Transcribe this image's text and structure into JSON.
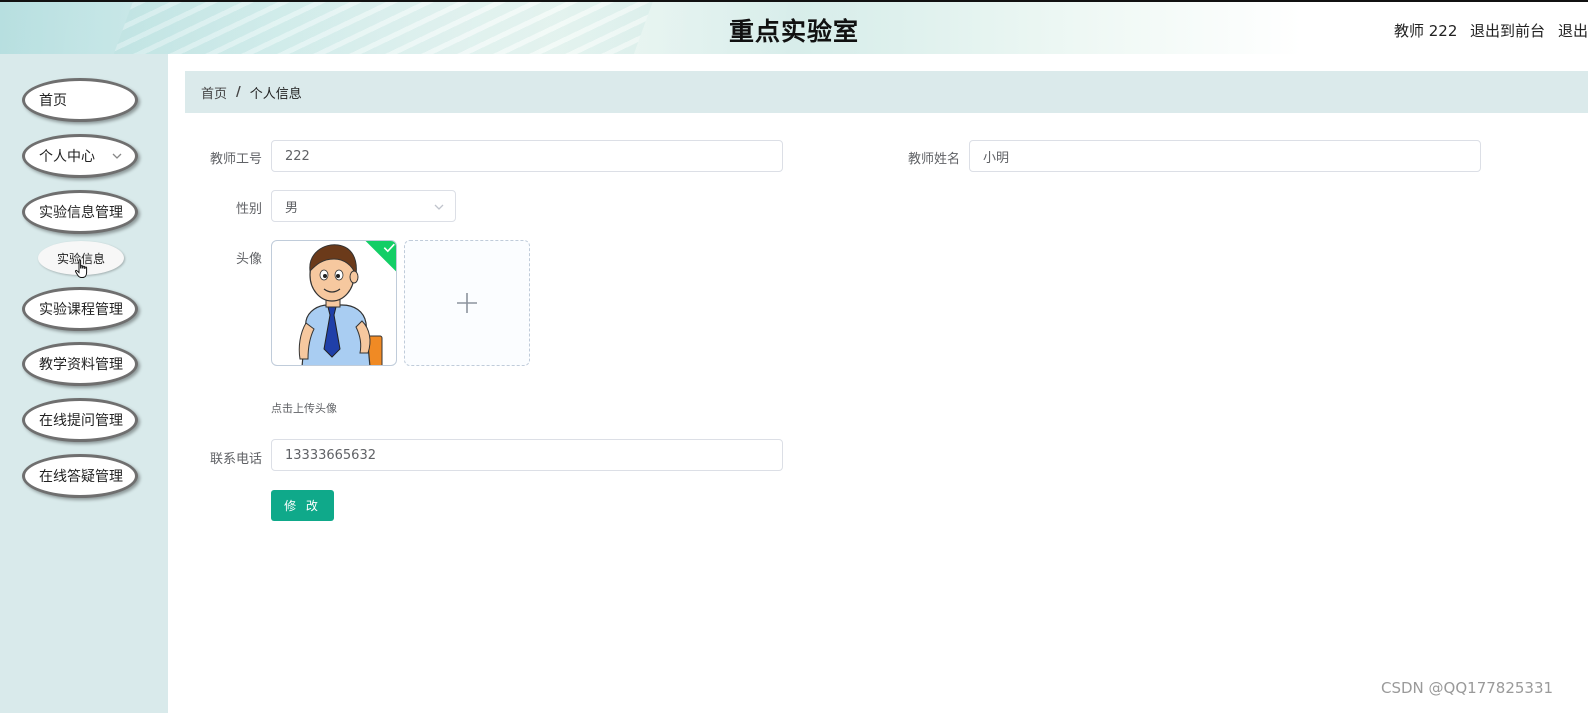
{
  "header": {
    "title": "重点实验室",
    "role_label": "教师 222",
    "front_link": "退出到前台",
    "logout_link": "退出"
  },
  "sidebar": {
    "items": [
      {
        "label": "首页"
      },
      {
        "label": "个人中心"
      },
      {
        "label": "实验信息管理"
      },
      {
        "label": "实验课程管理"
      },
      {
        "label": "教学资料管理"
      },
      {
        "label": "在线提问管理"
      },
      {
        "label": "在线答疑管理"
      }
    ],
    "submenu": [
      {
        "label": "实验信息"
      }
    ]
  },
  "breadcrumb": {
    "home": "首页",
    "separator": "/",
    "current": "个人信息"
  },
  "form": {
    "teacher_id_label": "教师工号",
    "teacher_id_value": "222",
    "teacher_name_label": "教师姓名",
    "teacher_name_value": "小明",
    "gender_label": "性别",
    "gender_value": "男",
    "avatar_label": "头像",
    "upload_tip": "点击上传头像",
    "phone_label": "联系电话",
    "phone_value": "13333665632",
    "submit_label": "修 改"
  },
  "icons": {
    "chevron": "chevron-down-icon",
    "upload": "plus-icon",
    "check": "check-icon",
    "cursor": "hand-cursor-icon"
  },
  "colors": {
    "sidebar_bg": "#d9eaeb",
    "primary_button": "#0fa98a",
    "success_badge": "#13ce66"
  },
  "watermark": "CSDN @QQ177825331"
}
